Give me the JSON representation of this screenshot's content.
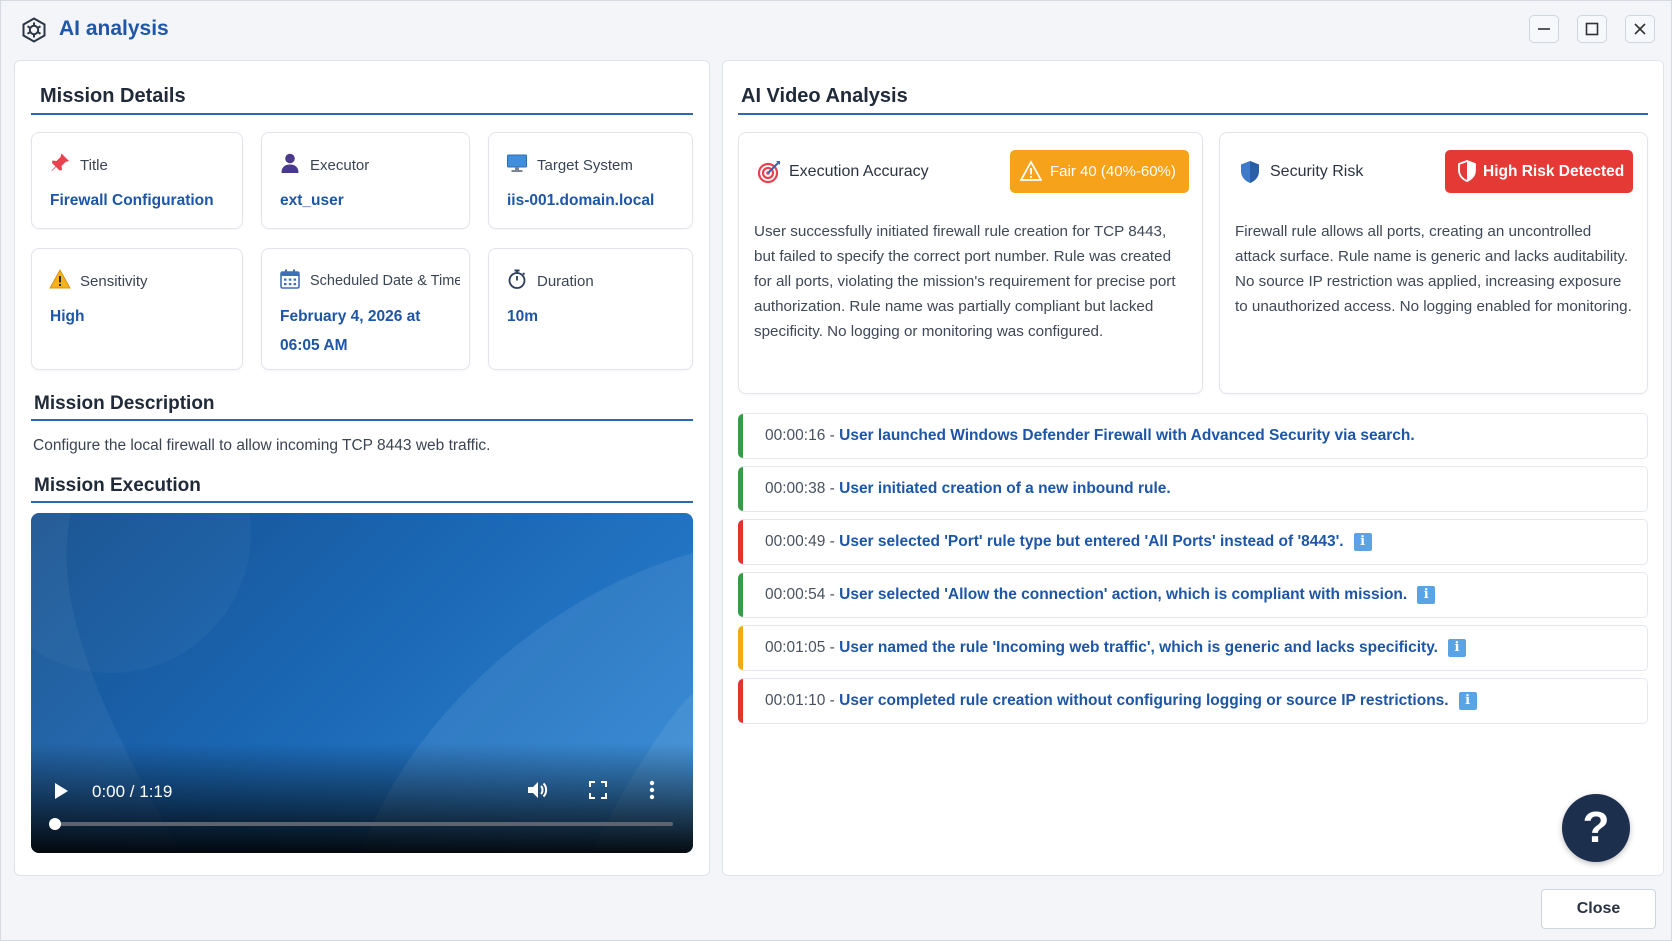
{
  "window": {
    "title": "AI analysis",
    "icon": "hexagon-gear-icon",
    "controls": [
      "minimize-icon",
      "maximize-icon",
      "close-icon"
    ]
  },
  "mission_details": {
    "heading": "Mission Details",
    "cards": [
      {
        "label": "Title",
        "value": "Firewall Configuration",
        "icon": "pin-icon"
      },
      {
        "label": "Executor",
        "value": "ext_user",
        "icon": "user-icon"
      },
      {
        "label": "Target System",
        "value": "iis-001.domain.local",
        "icon": "monitor-icon"
      },
      {
        "label": "Sensitivity",
        "value": "High",
        "icon": "warning-icon"
      },
      {
        "label": "Scheduled Date & Time",
        "value": "February 4, 2026 at 06:05 AM",
        "icon": "calendar-icon"
      },
      {
        "label": "Duration",
        "value": "10m",
        "icon": "stopwatch-icon"
      }
    ]
  },
  "mission_description": {
    "heading": "Mission Description",
    "text": "Configure the local firewall to allow incoming TCP 8443 web traffic."
  },
  "mission_execution": {
    "heading": "Mission Execution",
    "video": {
      "time": "0:00 / 1:19",
      "progress": 0.0
    }
  },
  "ai_analysis": {
    "heading": "AI Video Analysis",
    "accuracy": {
      "title": "Execution Accuracy",
      "icon": "target-icon",
      "badge": "Fair 40 (40%-60%)",
      "badge_color": "#f7a21b",
      "text": "User successfully initiated firewall rule creation for TCP 8443, but failed to specify the correct port number. Rule was created for all ports, violating the mission's requirement for precise port authorization. Rule name was partially compliant but lacked specificity. No logging or monitoring was configured."
    },
    "risk": {
      "title": "Security Risk",
      "icon": "shield-icon",
      "badge": "High Risk Detected",
      "badge_color": "#e53935",
      "text": "Firewall rule allows all ports, creating an uncontrolled attack surface. Rule name is generic and lacks auditability. No source IP restriction was applied, increasing exposure to unauthorized access. No logging enabled for monitoring."
    },
    "timeline": [
      {
        "time": "00:00:16",
        "message": "User launched Windows Defender Firewall with Advanced Security via search.",
        "status_color": "#3a9a45",
        "info": false
      },
      {
        "time": "00:00:38",
        "message": "User initiated creation of a new inbound rule.",
        "status_color": "#3a9a45",
        "info": false
      },
      {
        "time": "00:00:49",
        "message": "User selected 'Port' rule type but entered 'All Ports' instead of '8443'.",
        "status_color": "#e0342f",
        "info": true
      },
      {
        "time": "00:00:54",
        "message": "User selected 'Allow the connection' action, which is compliant with mission.",
        "status_color": "#3a9a45",
        "info": true
      },
      {
        "time": "00:01:05",
        "message": "User named the rule 'Incoming web traffic', which is generic and lacks specificity.",
        "status_color": "#f2a91a",
        "info": true
      },
      {
        "time": "00:01:10",
        "message": "User completed rule creation without configuring logging or source IP restrictions.",
        "status_color": "#e0342f",
        "info": true
      }
    ]
  },
  "help_button": "?",
  "close_button": "Close"
}
